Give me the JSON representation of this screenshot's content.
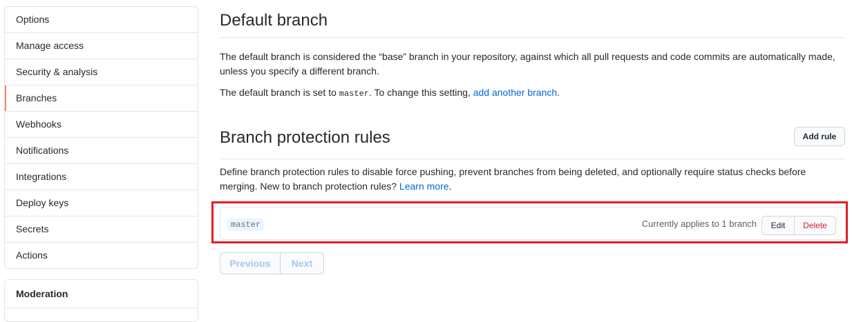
{
  "sidebar": {
    "items": [
      {
        "label": "Options"
      },
      {
        "label": "Manage access"
      },
      {
        "label": "Security & analysis"
      },
      {
        "label": "Branches"
      },
      {
        "label": "Webhooks"
      },
      {
        "label": "Notifications"
      },
      {
        "label": "Integrations"
      },
      {
        "label": "Deploy keys"
      },
      {
        "label": "Secrets"
      },
      {
        "label": "Actions"
      }
    ],
    "selected": "Branches",
    "accent_color": "#f9826c"
  },
  "moderation": {
    "header": "Moderation"
  },
  "default_branch": {
    "title": "Default branch",
    "description": "The default branch is considered the “base” branch in your repository, against which all pull requests and code commits are automatically made, unless you specify a different branch.",
    "set_prefix": "The default branch is set to ",
    "branch": "master",
    "set_middle": ". To change this setting, ",
    "change_link": "add another branch",
    "set_suffix": "."
  },
  "protection": {
    "title": "Branch protection rules",
    "add_rule_label": "Add rule",
    "description": "Define branch protection rules to disable force pushing, prevent branches from being deleted, and optionally require status checks before merging. New to branch protection rules? ",
    "learn_more": "Learn more",
    "learn_more_suffix": ".",
    "rules": [
      {
        "pattern": "master",
        "applies": "Currently applies to 1 branch",
        "edit_label": "Edit",
        "delete_label": "Delete"
      }
    ]
  },
  "pagination": {
    "previous": "Previous",
    "next": "Next"
  },
  "colors": {
    "link": "#0366d6",
    "danger": "#cb2431",
    "highlight": "#e11d2a"
  }
}
